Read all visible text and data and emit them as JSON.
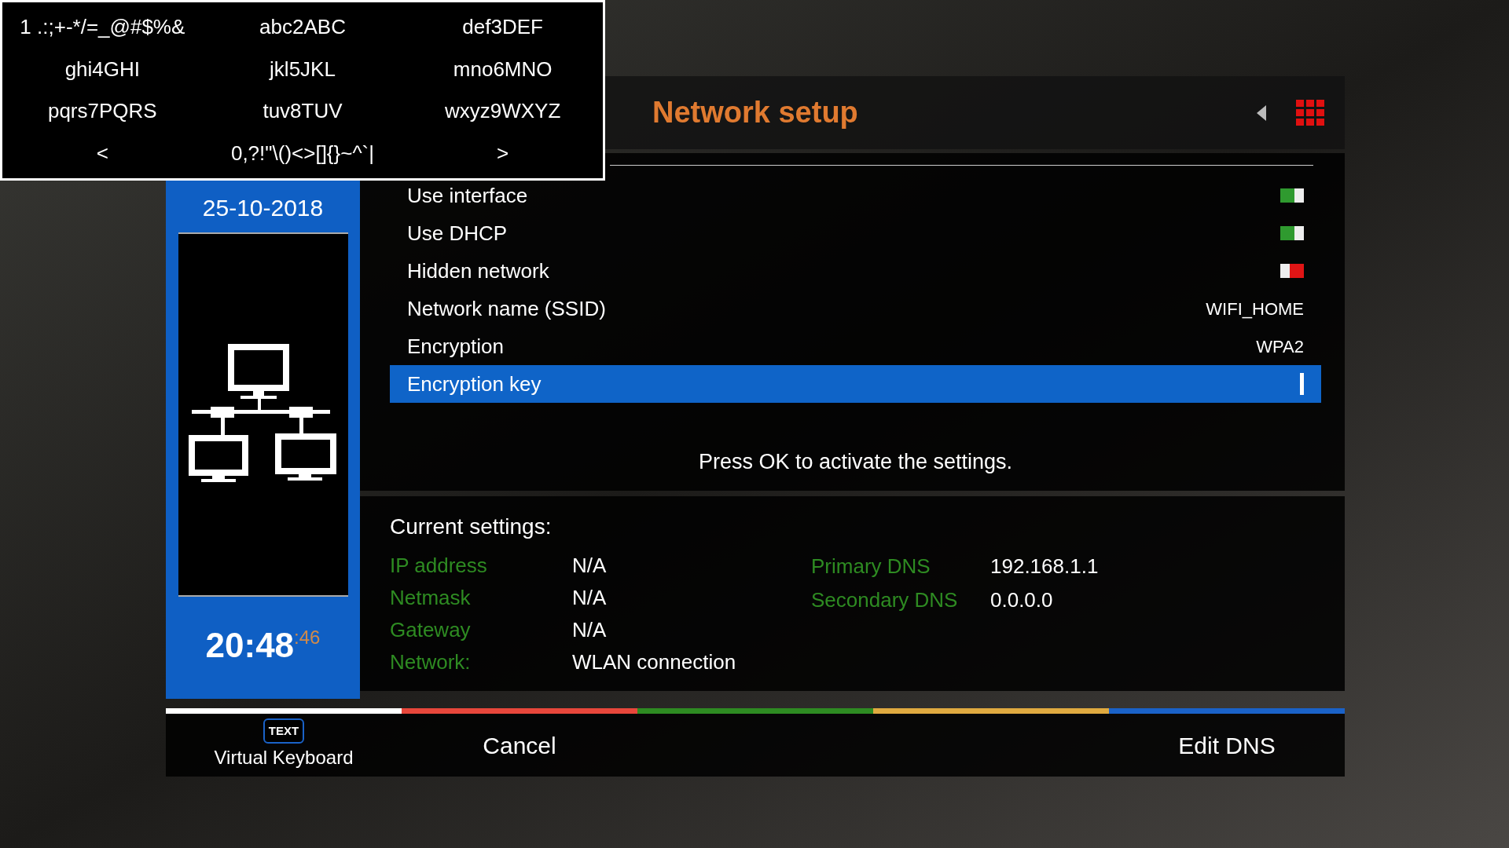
{
  "keyboard": {
    "rows": [
      [
        "1 .:;+-*/=_@#$%&",
        "abc2ABC",
        "def3DEF"
      ],
      [
        "ghi4GHI",
        "jkl5JKL",
        "mno6MNO"
      ],
      [
        "pqrs7PQRS",
        "tuv8TUV",
        "wxyz9WXYZ"
      ],
      [
        "<",
        "0,?!\"\\()<>[]{}~^`|",
        ">"
      ]
    ]
  },
  "sidebar": {
    "date": "25-10-2018",
    "time": "20:48",
    "seconds": ":46"
  },
  "header": {
    "title": "Network setup"
  },
  "settings": [
    {
      "label": "Use interface",
      "kind": "toggle",
      "on": true,
      "selected": false
    },
    {
      "label": "Use DHCP",
      "kind": "toggle",
      "on": true,
      "selected": false
    },
    {
      "label": "Hidden network",
      "kind": "toggle",
      "on": false,
      "selected": false
    },
    {
      "label": "Network name (SSID)",
      "kind": "text",
      "value": "WIFI_HOME",
      "selected": false
    },
    {
      "label": "Encryption",
      "kind": "text",
      "value": "WPA2",
      "selected": false
    },
    {
      "label": "Encryption key",
      "kind": "input",
      "selected": true
    }
  ],
  "hint": "Press OK to activate the settings.",
  "current_settings": {
    "title": "Current settings:",
    "rows": [
      {
        "label": "IP address",
        "value": "N/A"
      },
      {
        "label": "Netmask",
        "value": "N/A"
      },
      {
        "label": "Gateway",
        "value": "N/A"
      },
      {
        "label": "Network:",
        "value": "WLAN connection"
      }
    ],
    "dns": [
      {
        "label": "Primary DNS",
        "value": "192.168.1.1"
      },
      {
        "label": "Secondary DNS",
        "value": "0.0.0.0"
      }
    ]
  },
  "function_keys": [
    {
      "color": "#ffffff",
      "badge": "TEXT",
      "label": "Virtual Keyboard"
    },
    {
      "color": "#e8473b",
      "label": "Cancel"
    },
    {
      "color": "#2e8b22"
    },
    {
      "color": "#e0aa40"
    },
    {
      "color": "#1a62c8",
      "label": "Edit DNS"
    }
  ]
}
